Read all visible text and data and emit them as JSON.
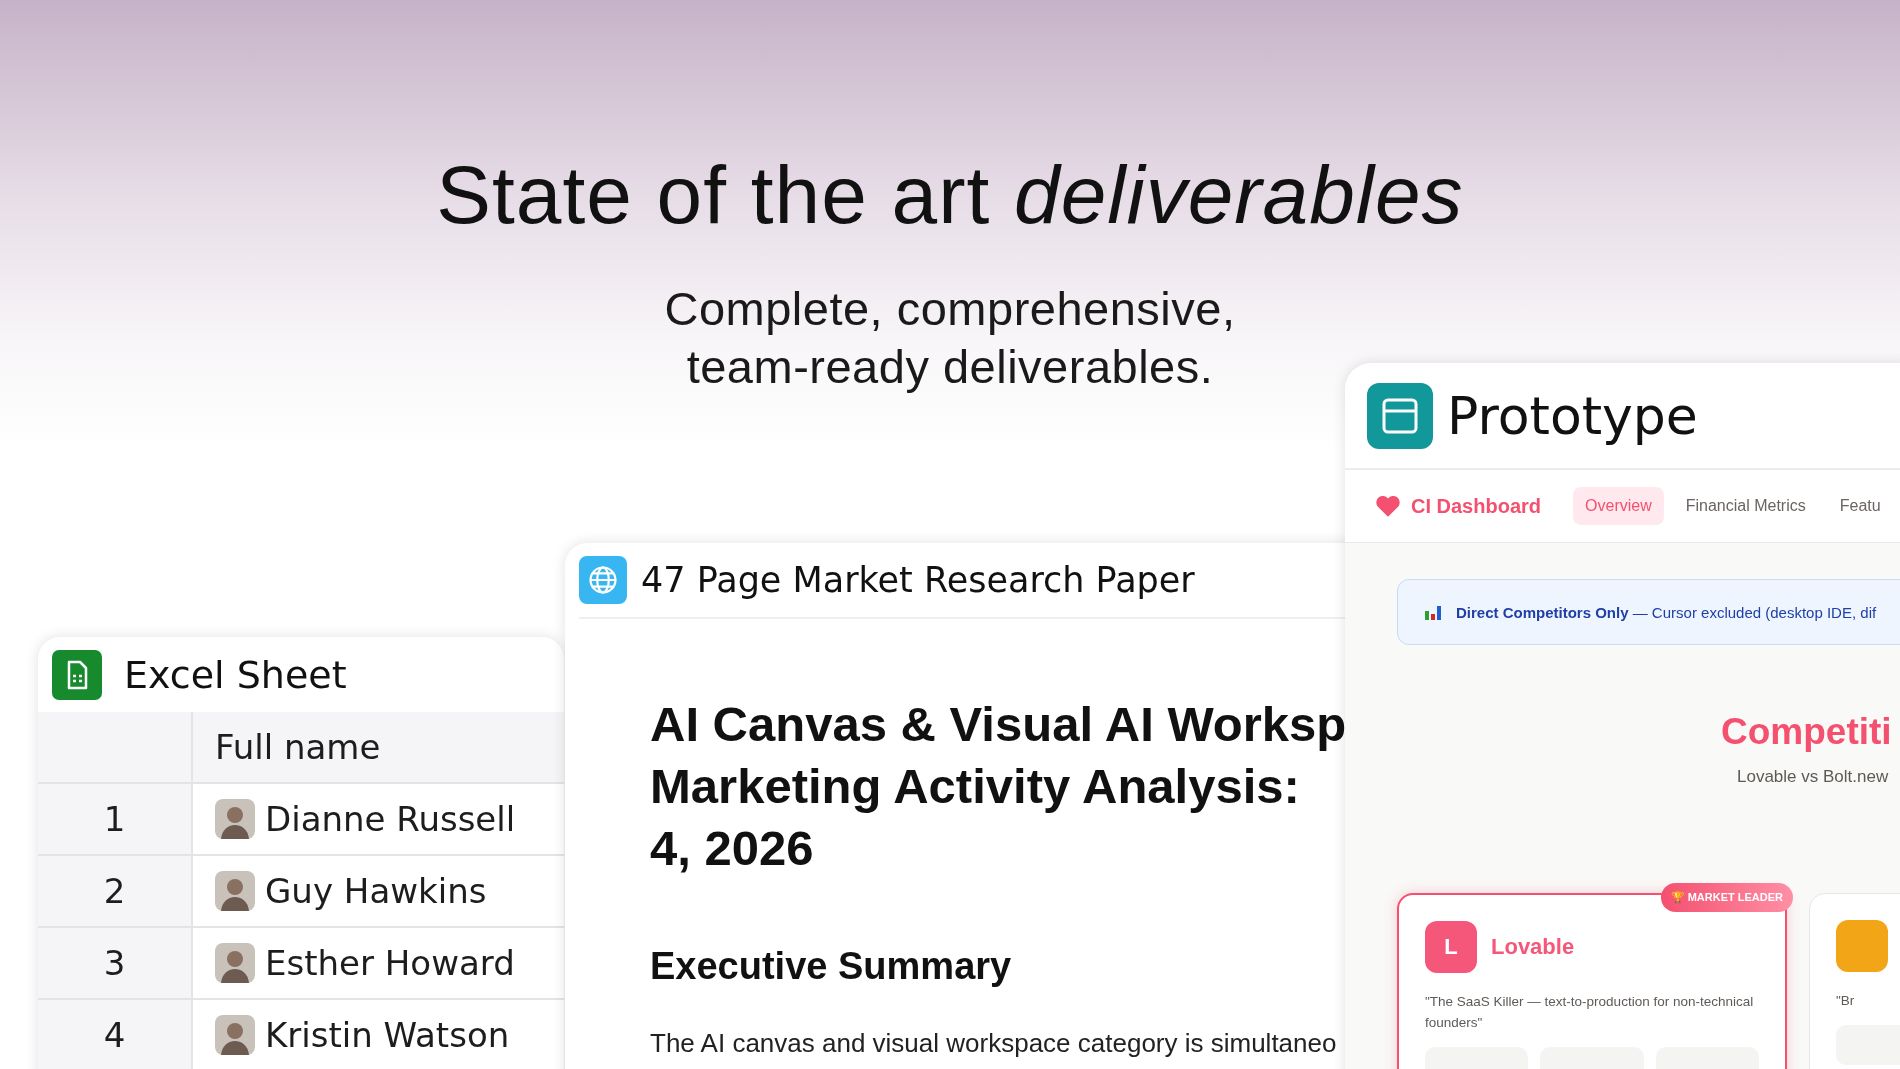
{
  "headline": {
    "text": "State of the art *deliverables*",
    "subtitle_lines": [
      "Complete, comprehensive,",
      "team-ready deliverables."
    ]
  },
  "excel_sheet": {
    "title": "Excel Sheet",
    "column": "Full name",
    "rows": [
      {
        "index": "1",
        "name": "Dianne Russell"
      },
      {
        "index": "2",
        "name": "Guy Hawkins"
      },
      {
        "index": "3",
        "name": "Esther Howard"
      },
      {
        "index": "4",
        "name": "Kristin Watson"
      }
    ]
  },
  "research_paper": {
    "title": "47 Page Market Research Paper",
    "heading_lines": [
      "AI Canvas & Visual AI Worksp",
      "Marketing Activity Analysis:",
      "4, 2026"
    ],
    "section_heading": "Executive Summary",
    "paragraph": "The AI canvas and visual workspace category is simultaneo"
  },
  "prototype": {
    "title": "Prototype",
    "app_name": "CI Dashboard",
    "tabs": [
      {
        "label": "Overview",
        "selected": true
      },
      {
        "label": "Financial Metrics",
        "selected": false
      },
      {
        "label": "Featu",
        "selected": false
      }
    ],
    "banner": "**Direct Competitors Only** — Cursor excluded (desktop IDE, dif",
    "section_title": "Competiti",
    "section_subtitle": "Lovable vs Bolt.new",
    "competitors": [
      {
        "initial": "L",
        "name": "Lovable",
        "badge": "🏆 MARKET LEADER",
        "quote": "\"The SaaS Killer — text-to-production for non-technical founders\"",
        "color": "#f5577a",
        "highlighted": true
      },
      {
        "quote": "\"Br",
        "color": "#f2a516",
        "highlighted": false
      }
    ]
  }
}
